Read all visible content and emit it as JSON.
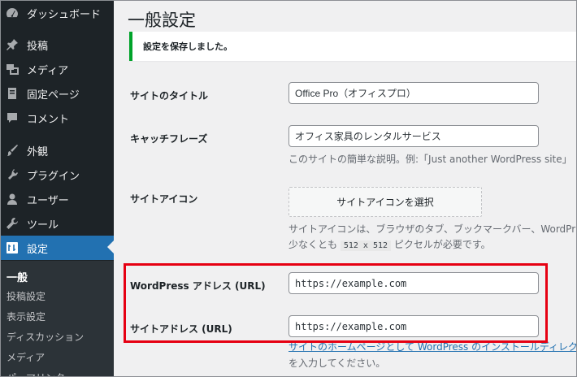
{
  "sidebar": {
    "items": [
      {
        "label": "ダッシュボード",
        "icon": "dashboard-icon"
      },
      {
        "label": "投稿",
        "icon": "pin-icon"
      },
      {
        "label": "メディア",
        "icon": "media-icon"
      },
      {
        "label": "固定ページ",
        "icon": "page-icon"
      },
      {
        "label": "コメント",
        "icon": "comment-icon"
      },
      {
        "label": "外観",
        "icon": "brush-icon"
      },
      {
        "label": "プラグイン",
        "icon": "plugin-icon"
      },
      {
        "label": "ユーザー",
        "icon": "user-icon"
      },
      {
        "label": "ツール",
        "icon": "wrench-icon"
      },
      {
        "label": "設定",
        "icon": "settings-icon",
        "active": true
      }
    ],
    "submenu": [
      "一般",
      "投稿設定",
      "表示設定",
      "ディスカッション",
      "メディア",
      "パーマリンク"
    ]
  },
  "main": {
    "title": "一般設定",
    "notice": "設定を保存しました。",
    "fields": {
      "site_title": {
        "label": "サイトのタイトル",
        "value": "Office Pro（オフィスプロ）"
      },
      "tagline": {
        "label": "キャッチフレーズ",
        "value": "オフィス家具のレンタルサービス",
        "description": "このサイトの簡単な説明。例:「Just another WordPress site」"
      },
      "site_icon": {
        "label": "サイトアイコン",
        "button": "サイトアイコンを選択",
        "description_line1": "サイトアイコンは、ブラウザのタブ、ブックマークバー、WordPr",
        "description_line2_pre": "少なくとも",
        "description_code": "512 x 512",
        "description_line2_post": "ピクセルが必要です。"
      },
      "wp_address": {
        "label": "WordPress アドレス (URL)",
        "value": "https://example.com"
      },
      "site_address": {
        "label": "サイトアドレス (URL)",
        "value": "https://example.com",
        "description_link": "サイトのホームページとして WordPress のインストールディレク",
        "description_rest": "を入力してください。"
      }
    }
  },
  "colors": {
    "sidebar_bg": "#1d2327",
    "active_bg": "#2271b1",
    "notice_border": "#00a32a",
    "highlight": "#e60012"
  }
}
